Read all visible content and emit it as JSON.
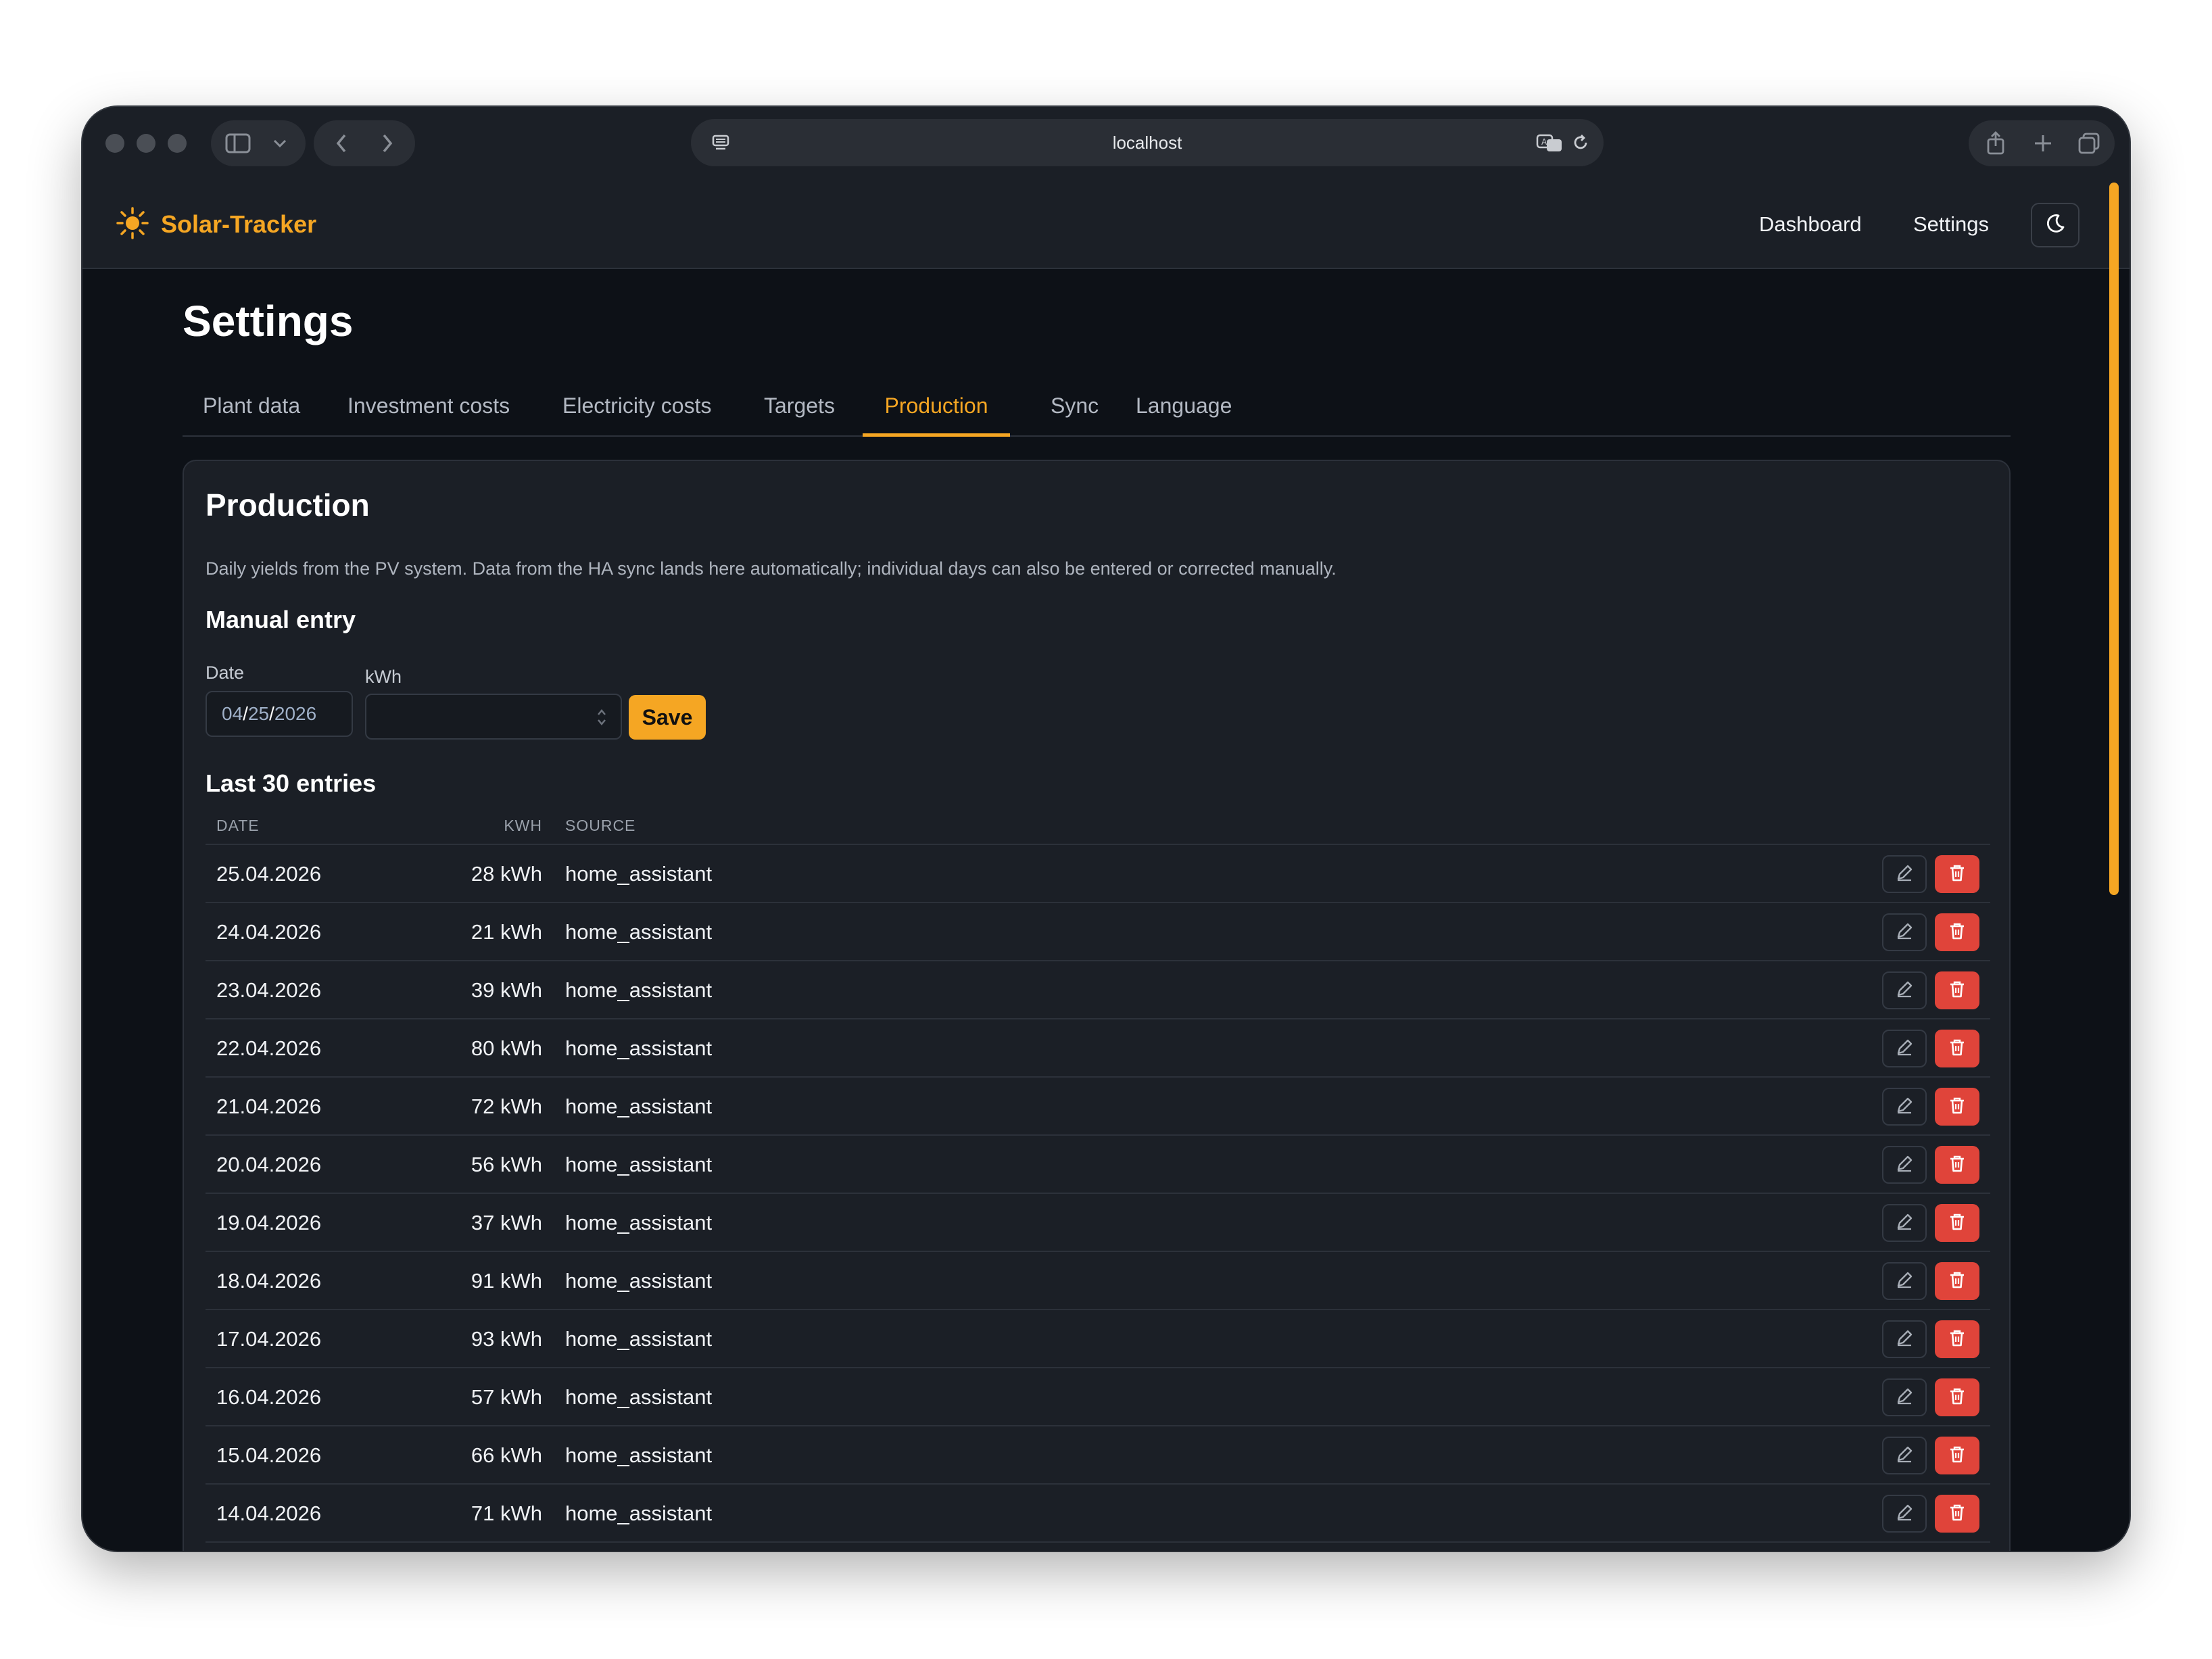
{
  "browser": {
    "url": "localhost"
  },
  "app": {
    "brand": "Solar-Tracker",
    "nav": {
      "dashboard": "Dashboard",
      "settings": "Settings"
    }
  },
  "page": {
    "title": "Settings",
    "tabs": [
      "Plant data",
      "Investment costs",
      "Electricity costs",
      "Targets",
      "Production",
      "Sync",
      "Language"
    ],
    "active_tab": "Production"
  },
  "production": {
    "title": "Production",
    "description": "Daily yields from the PV system. Data from the HA sync lands here automatically; individual days can also be entered or corrected manually.",
    "manual_entry": {
      "title": "Manual entry",
      "date_label": "Date",
      "date_month": "04",
      "date_day": "25",
      "date_year": "2026",
      "kwh_label": "kWh",
      "kwh_value": "",
      "save_label": "Save"
    },
    "entries": {
      "title": "Last 30 entries",
      "columns": {
        "date": "DATE",
        "kwh": "KWH",
        "source": "SOURCE"
      },
      "rows": [
        {
          "date": "25.04.2026",
          "kwh": "28 kWh",
          "source": "home_assistant"
        },
        {
          "date": "24.04.2026",
          "kwh": "21 kWh",
          "source": "home_assistant"
        },
        {
          "date": "23.04.2026",
          "kwh": "39 kWh",
          "source": "home_assistant"
        },
        {
          "date": "22.04.2026",
          "kwh": "80 kWh",
          "source": "home_assistant"
        },
        {
          "date": "21.04.2026",
          "kwh": "72 kWh",
          "source": "home_assistant"
        },
        {
          "date": "20.04.2026",
          "kwh": "56 kWh",
          "source": "home_assistant"
        },
        {
          "date": "19.04.2026",
          "kwh": "37 kWh",
          "source": "home_assistant"
        },
        {
          "date": "18.04.2026",
          "kwh": "91 kWh",
          "source": "home_assistant"
        },
        {
          "date": "17.04.2026",
          "kwh": "93 kWh",
          "source": "home_assistant"
        },
        {
          "date": "16.04.2026",
          "kwh": "57 kWh",
          "source": "home_assistant"
        },
        {
          "date": "15.04.2026",
          "kwh": "66 kWh",
          "source": "home_assistant"
        },
        {
          "date": "14.04.2026",
          "kwh": "71 kWh",
          "source": "home_assistant"
        }
      ]
    }
  },
  "colors": {
    "accent": "#f5a623",
    "danger": "#e0443a",
    "background": "#0d1117",
    "surface": "#1b1f26"
  },
  "icons": {
    "brand": "sun-icon",
    "theme_toggle": "moon-icon",
    "edit": "pencil-icon",
    "delete": "trash-icon"
  }
}
